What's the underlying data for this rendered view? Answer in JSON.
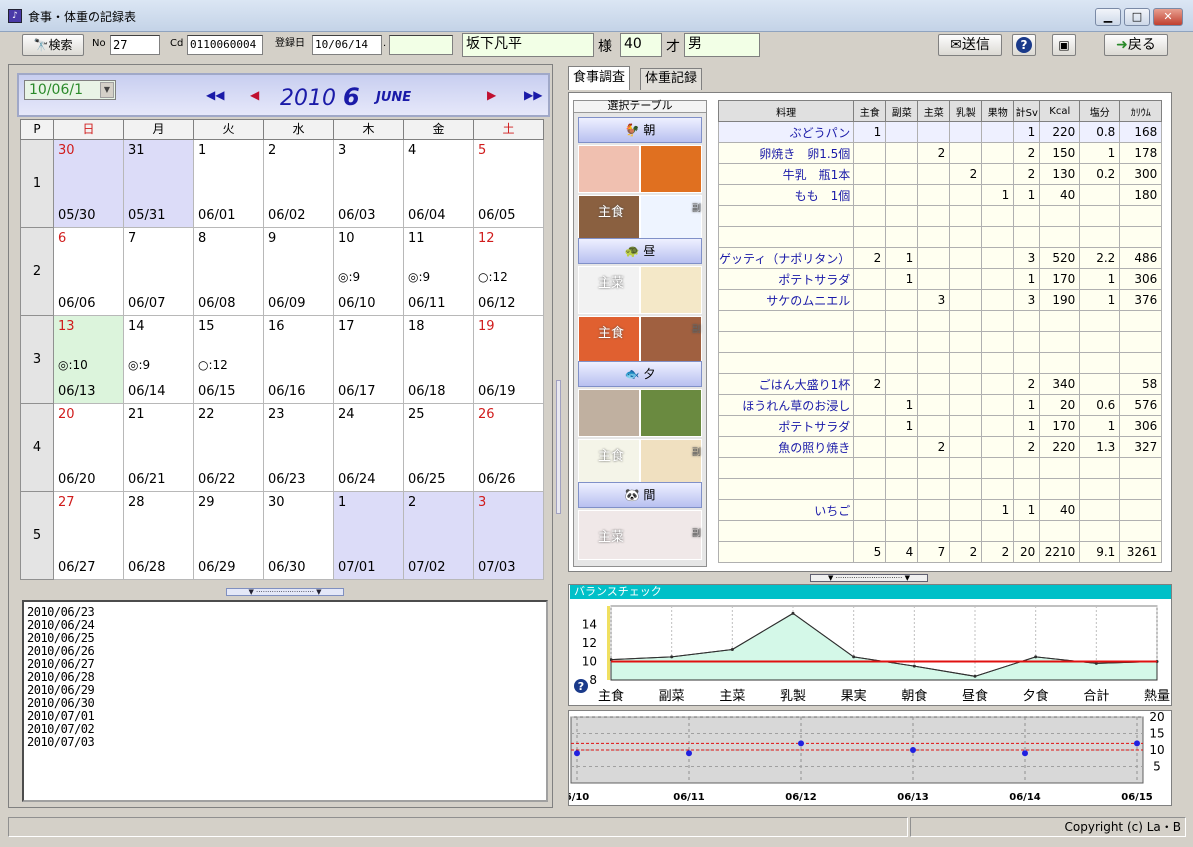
{
  "window": {
    "title": "食事・体重の記録表"
  },
  "toolbar": {
    "search": "検索",
    "no_label": "No",
    "no_value": "27",
    "cd_label": "Cd",
    "cd_value": "0110060004",
    "reg_label": "登録日",
    "reg_value": "10/06/14",
    "reg_extra": "",
    "name": "坂下凡平",
    "honorific": "様",
    "age": "40",
    "age_unit": "才",
    "sex": "男",
    "send": "送信",
    "back": "戻る"
  },
  "calendar": {
    "date_combo": "10/06/1",
    "year": "2010",
    "month": "6",
    "month_name": "JUNE",
    "header": [
      "P",
      "日",
      "月",
      "火",
      "水",
      "木",
      "金",
      "土"
    ],
    "weeks": [
      {
        "no": "1",
        "days": [
          {
            "n": "30",
            "m": "",
            "l": "05/30"
          },
          {
            "n": "31",
            "m": "",
            "l": "05/31"
          },
          {
            "n": "1",
            "m": "",
            "l": "06/01"
          },
          {
            "n": "2",
            "m": "",
            "l": "06/02"
          },
          {
            "n": "3",
            "m": "",
            "l": "06/03"
          },
          {
            "n": "4",
            "m": "",
            "l": "06/04"
          },
          {
            "n": "5",
            "m": "",
            "l": "06/05"
          }
        ]
      },
      {
        "no": "2",
        "days": [
          {
            "n": "6",
            "m": "",
            "l": "06/06"
          },
          {
            "n": "7",
            "m": "",
            "l": "06/07"
          },
          {
            "n": "8",
            "m": "",
            "l": "06/08"
          },
          {
            "n": "9",
            "m": "",
            "l": "06/09"
          },
          {
            "n": "10",
            "m": "◎:9",
            "l": "06/10"
          },
          {
            "n": "11",
            "m": "◎:9",
            "l": "06/11"
          },
          {
            "n": "12",
            "m": "○:12",
            "l": "06/12"
          }
        ]
      },
      {
        "no": "3",
        "days": [
          {
            "n": "13",
            "m": "◎:10",
            "l": "06/13"
          },
          {
            "n": "14",
            "m": "◎:9",
            "l": "06/14"
          },
          {
            "n": "15",
            "m": "○:12",
            "l": "06/15"
          },
          {
            "n": "16",
            "m": "",
            "l": "06/16"
          },
          {
            "n": "17",
            "m": "",
            "l": "06/17"
          },
          {
            "n": "18",
            "m": "",
            "l": "06/18"
          },
          {
            "n": "19",
            "m": "",
            "l": "06/19"
          }
        ]
      },
      {
        "no": "4",
        "days": [
          {
            "n": "20",
            "m": "",
            "l": "06/20"
          },
          {
            "n": "21",
            "m": "",
            "l": "06/21"
          },
          {
            "n": "22",
            "m": "",
            "l": "06/22"
          },
          {
            "n": "23",
            "m": "",
            "l": "06/23"
          },
          {
            "n": "24",
            "m": "",
            "l": "06/24"
          },
          {
            "n": "25",
            "m": "",
            "l": "06/25"
          },
          {
            "n": "26",
            "m": "",
            "l": "06/26"
          }
        ]
      },
      {
        "no": "5",
        "days": [
          {
            "n": "27",
            "m": "",
            "l": "06/27"
          },
          {
            "n": "28",
            "m": "",
            "l": "06/28"
          },
          {
            "n": "29",
            "m": "",
            "l": "06/29"
          },
          {
            "n": "30",
            "m": "",
            "l": "06/30"
          },
          {
            "n": "1",
            "m": "",
            "l": "07/01"
          },
          {
            "n": "2",
            "m": "",
            "l": "07/02"
          },
          {
            "n": "3",
            "m": "",
            "l": "07/03"
          }
        ]
      }
    ]
  },
  "log": [
    "2010/06/23",
    "2010/06/24",
    "2010/06/25",
    "2010/06/26",
    "2010/06/27",
    "2010/06/28",
    "2010/06/29",
    "2010/06/30",
    "2010/07/01",
    "2010/07/02",
    "2010/07/03"
  ],
  "tabs": [
    "食事調査",
    "体重記録"
  ],
  "meal_select": {
    "title": "選択テーブル",
    "meals": [
      {
        "name": "朝",
        "tags": [
          "主食",
          "副"
        ]
      },
      {
        "name": "昼",
        "tags": [
          "主菜",
          "主食",
          "副"
        ]
      },
      {
        "name": "夕",
        "tags": [
          "主食",
          "副"
        ]
      },
      {
        "name": "間",
        "tags": [
          "主菜",
          "副"
        ]
      }
    ]
  },
  "grid": {
    "headers": [
      "料理",
      "主食",
      "副菜",
      "主菜",
      "乳製",
      "果物",
      "計Sv",
      "Kcal",
      "塩分",
      "ｶﾘｳﾑ"
    ],
    "rows": [
      [
        "ぶどうパン",
        "1",
        "",
        "",
        "",
        "",
        "1",
        "220",
        "0.8",
        "168"
      ],
      [
        "卵焼き　卵1.5個",
        "",
        "",
        "2",
        "",
        "",
        "2",
        "150",
        "1",
        "178"
      ],
      [
        "牛乳　瓶1本",
        "",
        "",
        "",
        "2",
        "",
        "2",
        "130",
        "0.2",
        "300"
      ],
      [
        "もも　1個",
        "",
        "",
        "",
        "",
        "1",
        "1",
        "40",
        "",
        "180"
      ],
      [
        "",
        "",
        "",
        "",
        "",
        "",
        "",
        "",
        "",
        ""
      ],
      [
        "",
        "",
        "",
        "",
        "",
        "",
        "",
        "",
        "",
        ""
      ],
      [
        "ゲッティ（ナポリタン）",
        "2",
        "1",
        "",
        "",
        "",
        "3",
        "520",
        "2.2",
        "486"
      ],
      [
        "ポテトサラダ",
        "",
        "1",
        "",
        "",
        "",
        "1",
        "170",
        "1",
        "306"
      ],
      [
        "サケのムニエル",
        "",
        "",
        "3",
        "",
        "",
        "3",
        "190",
        "1",
        "376"
      ],
      [
        "",
        "",
        "",
        "",
        "",
        "",
        "",
        "",
        "",
        ""
      ],
      [
        "",
        "",
        "",
        "",
        "",
        "",
        "",
        "",
        "",
        ""
      ],
      [
        "",
        "",
        "",
        "",
        "",
        "",
        "",
        "",
        "",
        ""
      ],
      [
        "ごはん大盛り1杯",
        "2",
        "",
        "",
        "",
        "",
        "2",
        "340",
        "",
        "58"
      ],
      [
        "ほうれん草のお浸し",
        "",
        "1",
        "",
        "",
        "",
        "1",
        "20",
        "0.6",
        "576"
      ],
      [
        "ポテトサラダ",
        "",
        "1",
        "",
        "",
        "",
        "1",
        "170",
        "1",
        "306"
      ],
      [
        "魚の照り焼き",
        "",
        "",
        "2",
        "",
        "",
        "2",
        "220",
        "1.3",
        "327"
      ],
      [
        "",
        "",
        "",
        "",
        "",
        "",
        "",
        "",
        "",
        ""
      ],
      [
        "",
        "",
        "",
        "",
        "",
        "",
        "",
        "",
        "",
        ""
      ],
      [
        "いちご",
        "",
        "",
        "",
        "",
        "1",
        "1",
        "40",
        "",
        ""
      ],
      [
        "",
        "",
        "",
        "",
        "",
        "",
        "",
        "",
        "",
        ""
      ],
      [
        "",
        "5",
        "4",
        "7",
        "2",
        "2",
        "20",
        "2210",
        "9.1",
        "3261"
      ]
    ]
  },
  "balance": {
    "title": "バランスチェック",
    "help": "?"
  },
  "chart_data": [
    {
      "type": "area",
      "title": "バランスチェック",
      "categories": [
        "主食",
        "副菜",
        "主菜",
        "乳製",
        "果実",
        "朝食",
        "昼食",
        "夕食",
        "合計",
        "熱量"
      ],
      "yticks": [
        "14",
        "12",
        "10",
        "8"
      ],
      "ylim": [
        8,
        16
      ],
      "series": [
        {
          "values": [
            10.2,
            10.5,
            11.3,
            15.2,
            10.5,
            9.5,
            8.4,
            10.5,
            9.8,
            10
          ]
        }
      ],
      "reference": 10
    },
    {
      "type": "scatter",
      "categories": [
        "6/10",
        "06/11",
        "06/12",
        "06/13",
        "06/14",
        "06/15"
      ],
      "yticks": [
        "20",
        "15",
        "10",
        "5"
      ],
      "ylim": [
        0,
        20
      ],
      "series": [
        {
          "values": [
            9,
            9,
            12,
            10,
            9,
            12
          ]
        }
      ],
      "band": [
        10,
        12
      ]
    }
  ],
  "status": {
    "copyright": "Copyright (c)  La・B"
  }
}
